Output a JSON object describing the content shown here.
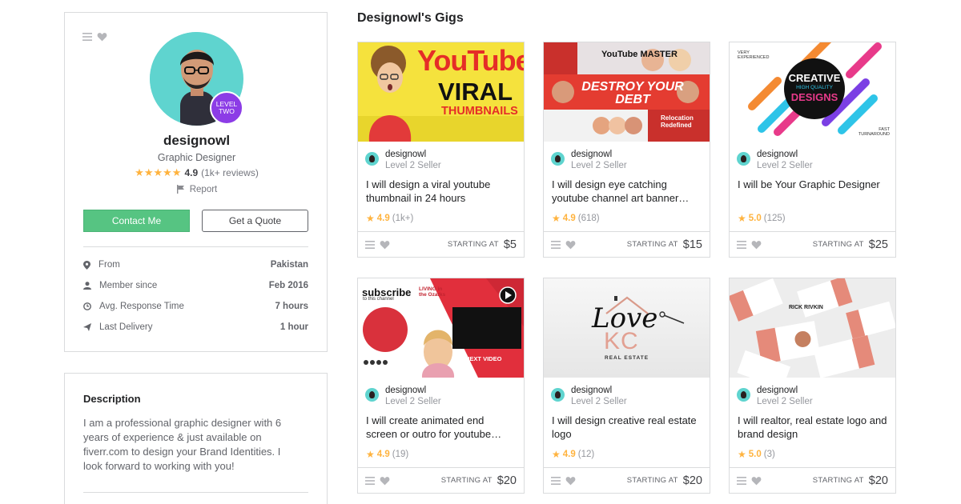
{
  "profile": {
    "name": "designowl",
    "title": "Graphic Designer",
    "level_badge": [
      "LEVEL",
      "TWO"
    ],
    "rating": "4.9",
    "reviews": "(1k+ reviews)",
    "report_label": "Report",
    "contact_label": "Contact Me",
    "quote_label": "Get a Quote",
    "stats": [
      {
        "icon": "location-pin-icon",
        "label": "From",
        "value": "Pakistan"
      },
      {
        "icon": "user-icon",
        "label": "Member since",
        "value": "Feb 2016"
      },
      {
        "icon": "clock-icon",
        "label": "Avg. Response Time",
        "value": "7 hours"
      },
      {
        "icon": "paper-plane-icon",
        "label": "Last Delivery",
        "value": "1 hour"
      }
    ]
  },
  "description": {
    "title": "Description",
    "text": "I am a professional graphic designer with 6 years of experience & just available on fiverr.com to design your Brand Identities. I look forward to working with you!"
  },
  "gigs_title": "Designowl's Gigs",
  "gigs": [
    {
      "seller": "designowl",
      "level": "Level 2 Seller",
      "title": "I will design a viral youtube thumbnail in 24 hours",
      "rating": "4.9",
      "count": "(1k+)",
      "starting": "STARTING AT",
      "price": "$5"
    },
    {
      "seller": "designowl",
      "level": "Level 2 Seller",
      "title": "I will design eye catching youtube channel art banner…",
      "rating": "4.9",
      "count": "(618)",
      "starting": "STARTING AT",
      "price": "$15"
    },
    {
      "seller": "designowl",
      "level": "Level 2 Seller",
      "title": "I will be Your Graphic Designer",
      "rating": "5.0",
      "count": "(125)",
      "starting": "STARTING AT",
      "price": "$25"
    },
    {
      "seller": "designowl",
      "level": "Level 2 Seller",
      "title": "I will create animated end screen or outro for youtube…",
      "rating": "4.9",
      "count": "(19)",
      "starting": "STARTING AT",
      "price": "$20"
    },
    {
      "seller": "designowl",
      "level": "Level 2 Seller",
      "title": "I will design creative real estate logo",
      "rating": "4.9",
      "count": "(12)",
      "starting": "STARTING AT",
      "price": "$20"
    },
    {
      "seller": "designowl",
      "level": "Level 2 Seller",
      "title": "I will realtor, real estate logo and brand design",
      "rating": "5.0",
      "count": "(3)",
      "starting": "STARTING AT",
      "price": "$20"
    }
  ],
  "thumbs": {
    "yt": {
      "line1": "YouTube",
      "line2": "VIRAL",
      "line3": "THUMBNAILS"
    },
    "banner": {
      "top": "YouTube MASTER",
      "mid": "DESTROY YOUR DEBT",
      "bottom": "Relocation Redefined"
    },
    "creative": {
      "l1": "CREATIVE",
      "l2": "HIGH QUALITY",
      "l3": "DESIGNS",
      "corner1": "VERY EXPERIENCED",
      "corner2": "FAST TURNAROUND"
    },
    "endscreen": {
      "sub": "subscribe",
      "sub2": "to this channel",
      "next": "NEXT VIDEO",
      "logo": "LIVING in the Ozarks"
    },
    "lovekc": {
      "love": "Love",
      "kc": "KC",
      "re": "REAL ESTATE"
    },
    "cards": {
      "name": "RICK RIVKIN"
    }
  },
  "colors": {
    "accent_green": "#56c482",
    "star": "#ffb33e",
    "badge_purple": "#8c3ce6",
    "avatar_bg": "#5fd4cf"
  }
}
